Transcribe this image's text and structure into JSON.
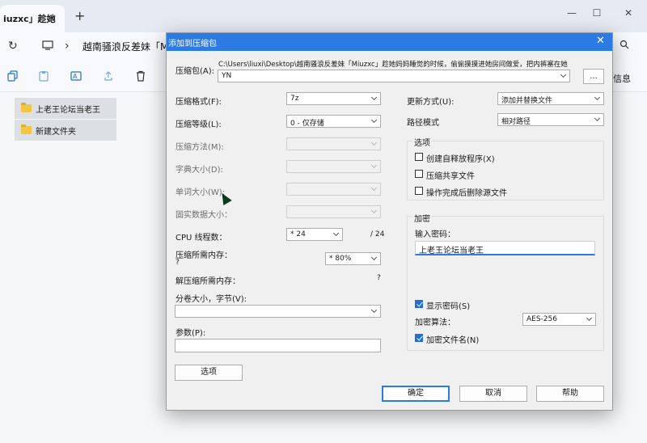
{
  "browser": {
    "tab_title": "iuzxc」趁她",
    "tab_close": "×",
    "new_tab": "+",
    "window_controls": {
      "minimize": "—",
      "maximize": "☐",
      "close": "✕"
    },
    "breadcrumb": "越南骚浪反差妹「M"
  },
  "toolbar": {
    "right_label": "信息",
    "icons": [
      "copy-icon",
      "paste-icon",
      "rename-icon",
      "share-icon",
      "delete-icon"
    ]
  },
  "files": [
    {
      "name": "上老王论坛当老王"
    },
    {
      "name": "新建文件夹"
    }
  ],
  "dialog": {
    "title": "添加到压缩包",
    "close": "✕",
    "archive": {
      "label": "压缩包(A):",
      "path": "C:\\Users\\liuxi\\Desktop\\越南骚浪反差妹「Miuzxc」趁她妈妈睡觉的时候，偷偷摸摸进她房间做爱，把内裤塞在她",
      "name": "YN",
      "browse": "..."
    },
    "left": {
      "format_label": "压缩格式(F):",
      "format_value": "7z",
      "level_label": "压缩等级(L):",
      "level_value": "0 - 仅存储",
      "method_label": "压缩方法(M):",
      "dict_label": "字典大小(D):",
      "word_label": "单词大小(W):",
      "solid_label": "固实数据大小：",
      "cpu_label": "CPU 线程数：",
      "cpu_value": "* 24",
      "cpu_max": "/ 24",
      "mem_comp_label": "压缩所需内存：",
      "mem_comp_value": "?",
      "mem_percent": "* 80%",
      "mem_decomp_label": "解压缩所需内存：",
      "mem_decomp_value": "?",
      "volume_label": "分卷大小，字节(V):",
      "volume_value": "",
      "params_label": "参数(P):",
      "params_value": "",
      "options_button": "选项"
    },
    "right": {
      "update_label": "更新方式(U):",
      "update_value": "添加并替换文件",
      "path_label": "路径模式",
      "path_value": "相对路径",
      "options_title": "选项",
      "opt_sfx": "创建自释放程序(X)",
      "opt_shared": "压缩共享文件",
      "opt_delete": "操作完成后删除源文件",
      "encrypt_title": "加密",
      "password_label": "输入密码：",
      "password_value": "上老王论坛当老王",
      "show_password": "显示密码(S)",
      "algo_label": "加密算法：",
      "algo_value": "AES-256",
      "encrypt_names": "加密文件名(N)"
    },
    "buttons": {
      "ok": "确定",
      "cancel": "取消",
      "help": "帮助"
    }
  }
}
